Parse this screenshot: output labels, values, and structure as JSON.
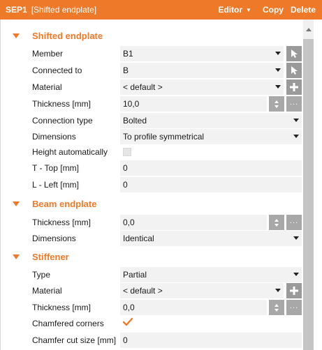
{
  "header": {
    "id": "SEP1",
    "name": "[Shifted endplate]",
    "editor_label": "Editor",
    "copy_label": "Copy",
    "delete_label": "Delete"
  },
  "sections": {
    "shifted": {
      "title": "Shifted endplate",
      "member": {
        "label": "Member",
        "value": "B1"
      },
      "connected_to": {
        "label": "Connected to",
        "value": "B"
      },
      "material": {
        "label": "Material",
        "value": "< default >"
      },
      "thickness": {
        "label": "Thickness [mm]",
        "value": "10,0"
      },
      "connection_type": {
        "label": "Connection type",
        "value": "Bolted"
      },
      "dimensions": {
        "label": "Dimensions",
        "value": "To profile symmetrical"
      },
      "height_auto": {
        "label": "Height automatically",
        "checked": false
      },
      "t_top": {
        "label": "T - Top [mm]",
        "value": "0"
      },
      "l_left": {
        "label": "L - Left [mm]",
        "value": "0"
      }
    },
    "beam": {
      "title": "Beam endplate",
      "thickness": {
        "label": "Thickness [mm]",
        "value": "0,0"
      },
      "dimensions": {
        "label": "Dimensions",
        "value": "Identical"
      }
    },
    "stiffener": {
      "title": "Stiffener",
      "type": {
        "label": "Type",
        "value": "Partial"
      },
      "material": {
        "label": "Material",
        "value": "< default >"
      },
      "thickness": {
        "label": "Thickness [mm]",
        "value": "0,0"
      },
      "chamfered": {
        "label": "Chamfered corners",
        "checked": true
      },
      "chamfer_size": {
        "label": "Chamfer cut size [mm]",
        "value": "0"
      }
    }
  },
  "colors": {
    "accent": "#ee7a29",
    "field_bg": "#f2f2f2",
    "button_bg": "#9a9a9a"
  },
  "icons": {
    "pick": "cursor-arrow-icon",
    "add": "plus-icon",
    "more": "ellipsis-icon",
    "spin": "spinner-icon"
  }
}
